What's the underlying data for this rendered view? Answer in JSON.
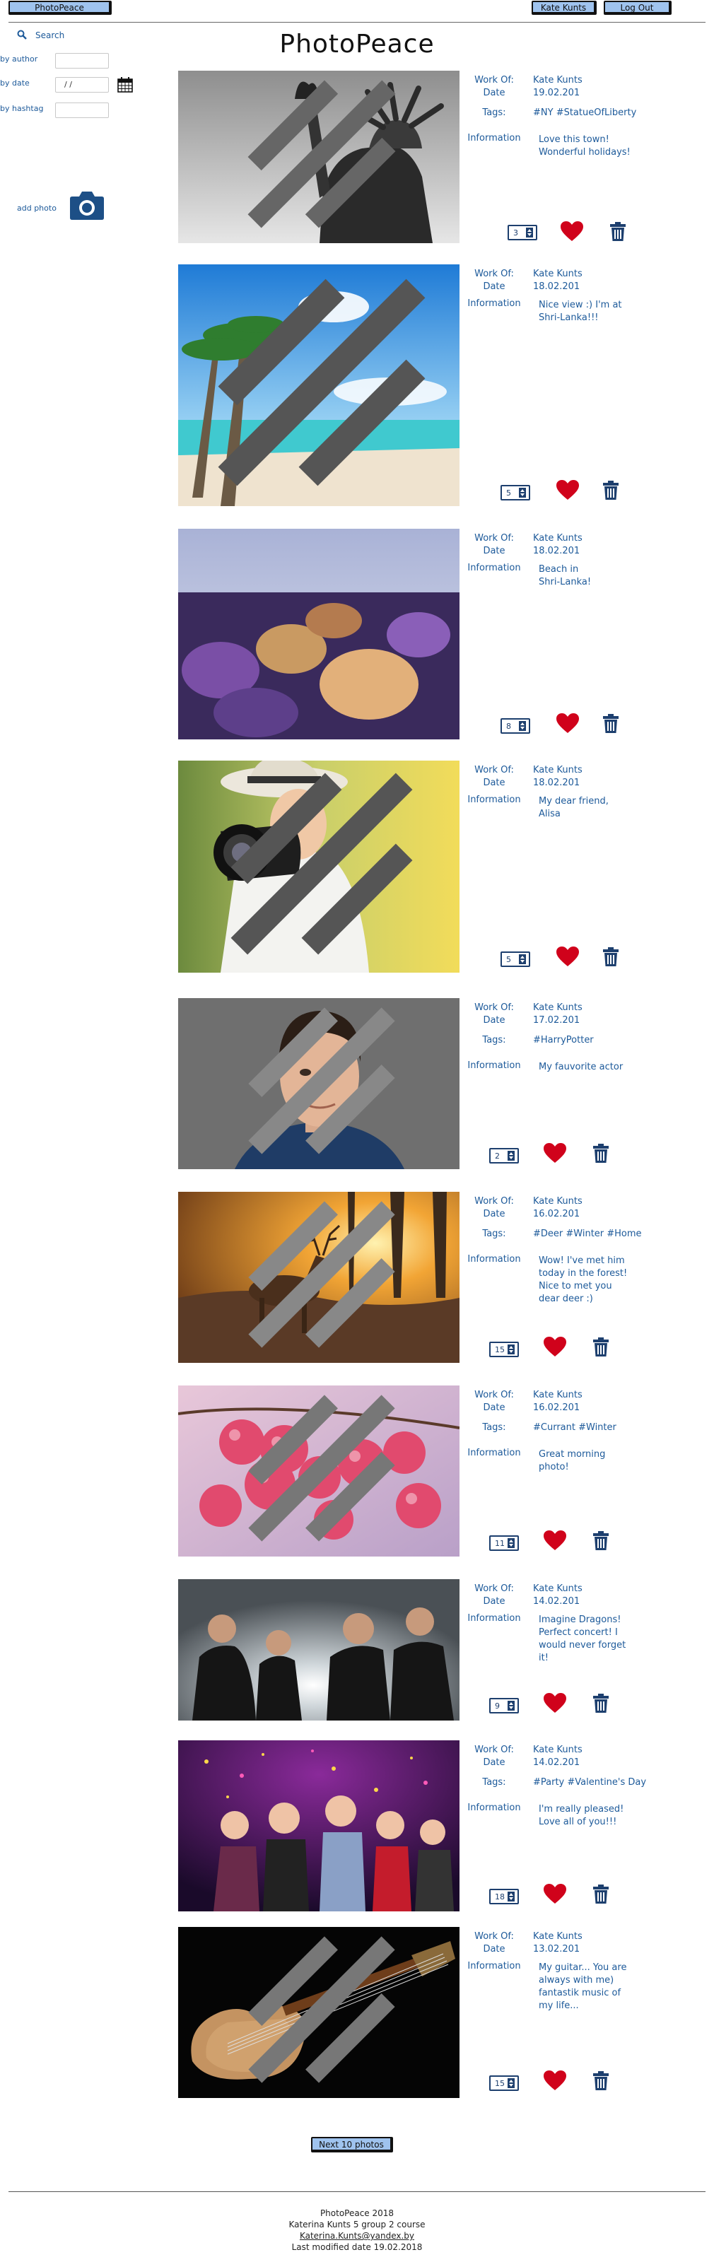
{
  "header": {
    "brand": "PhotoPeace",
    "user": "Kate Kunts",
    "logout": "Log Out"
  },
  "title": "PhotoPeace",
  "sidebar": {
    "search_label": "Search",
    "by_author": "by author",
    "by_date": "by date",
    "date_value": "/ /",
    "by_hashtag": "by hashtag",
    "add_photo": "add photo"
  },
  "labels": {
    "work_of": "Work Of:",
    "date": "Date",
    "tags": "Tags:",
    "information": "Information"
  },
  "posts": [
    {
      "author": "Kate Kunts",
      "date": "19.02.201",
      "tags": "#NY #StatueOfLiberty",
      "info": [
        "Love this town!",
        "Wonderful holidays!"
      ],
      "likes": "3"
    },
    {
      "author": "Kate Kunts",
      "date": "18.02.201",
      "tags": "",
      "info": [
        "Nice view :) I'm at",
        "Shri-Lanka!!!"
      ],
      "likes": "5"
    },
    {
      "author": "Kate Kunts",
      "date": "18.02.201",
      "tags": "",
      "info": [
        "Beach in",
        "Shri-Lanka!"
      ],
      "likes": "8"
    },
    {
      "author": "Kate Kunts",
      "date": "18.02.201",
      "tags": "",
      "info": [
        "My dear friend,",
        "Alisa"
      ],
      "likes": "5"
    },
    {
      "author": "Kate Kunts",
      "date": "17.02.201",
      "tags": "#HarryPotter",
      "info": [
        "My fauvorite actor"
      ],
      "likes": "2"
    },
    {
      "author": "Kate Kunts",
      "date": "16.02.201",
      "tags": "#Deer #Winter #Home",
      "info": [
        "Wow! I've met him",
        "today in the forest!",
        "Nice to met you",
        "dear deer :)"
      ],
      "likes": "15"
    },
    {
      "author": "Kate Kunts",
      "date": "16.02.201",
      "tags": "#Currant #Winter",
      "info": [
        "Great morning",
        "photo!"
      ],
      "likes": "11"
    },
    {
      "author": "Kate Kunts",
      "date": "14.02.201",
      "tags": "",
      "info": [
        "Imagine Dragons!",
        "Perfect concert! I",
        "would never forget",
        "it!"
      ],
      "likes": "9"
    },
    {
      "author": "Kate Kunts",
      "date": "14.02.201",
      "tags": "#Party #Valentine's Day",
      "info": [
        "I'm really pleased!",
        "Love all of you!!!"
      ],
      "likes": "18"
    },
    {
      "author": "Kate Kunts",
      "date": "13.02.201",
      "tags": "",
      "info": [
        "My guitar... You are",
        "always with me)",
        "fantastik music of",
        "my life..."
      ],
      "likes": "15"
    }
  ],
  "next_button": "Next 10 photos",
  "footer": {
    "line1": "PhotoPeace 2018",
    "line2": "Katerina Kunts 5 group 2 course",
    "email": "Katerina.Kunts@yandex.by",
    "line4": "Last modified date 19.02.2018"
  }
}
